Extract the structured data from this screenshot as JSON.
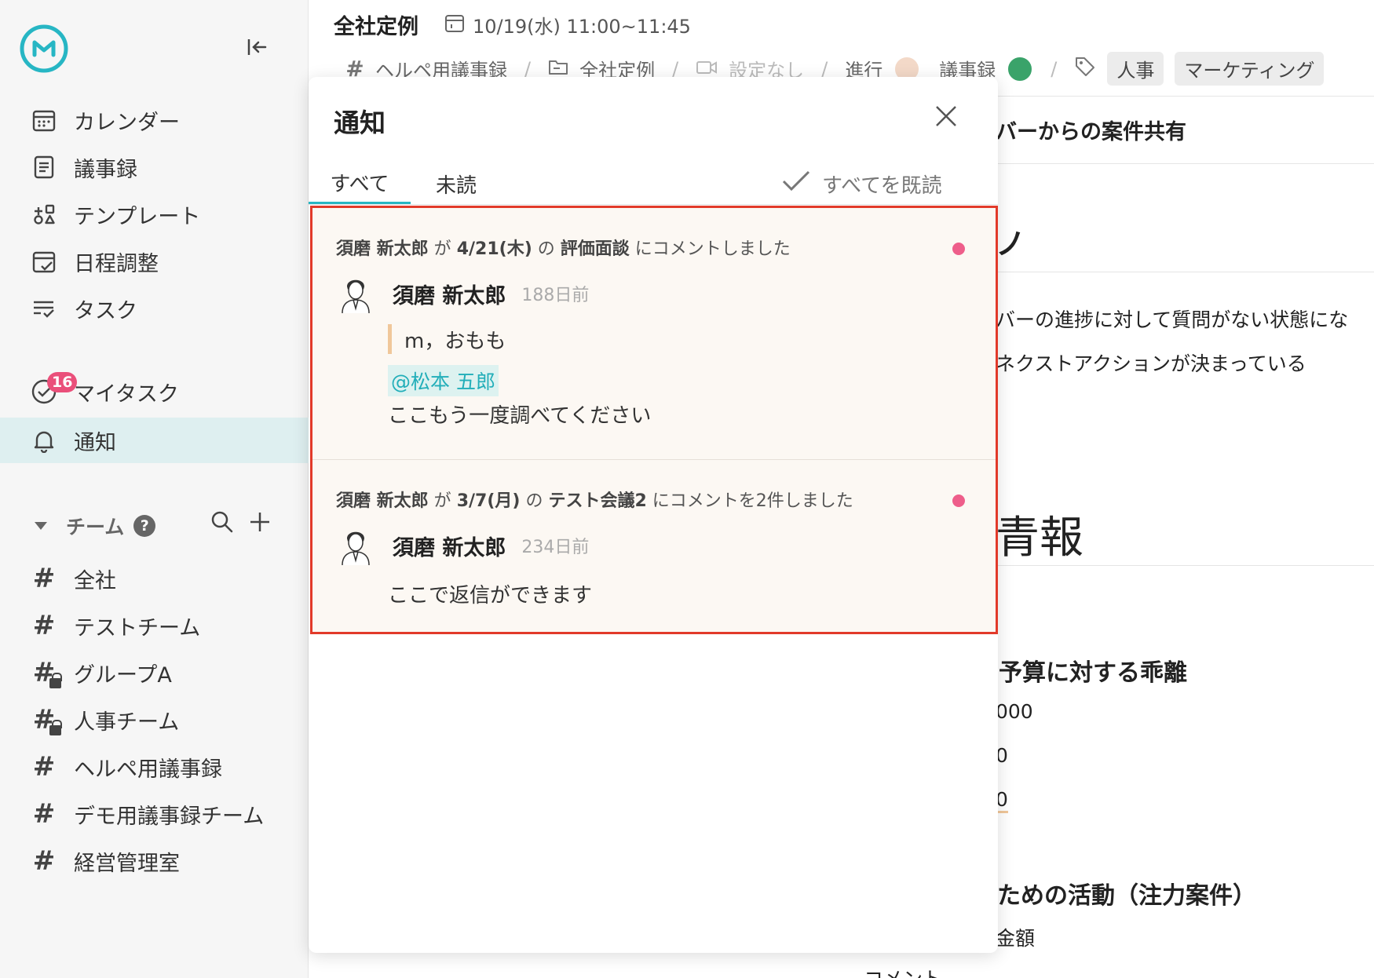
{
  "colors": {
    "accent": "#27b6c4",
    "badge": "#ea4f7a",
    "highlight_border": "#e23a2a",
    "unread_dot": "#ee5e8a"
  },
  "sidebar": {
    "logo": "app-logo",
    "nav": [
      {
        "label": "カレンダー",
        "icon": "calendar-icon"
      },
      {
        "label": "議事録",
        "icon": "document-icon"
      },
      {
        "label": "テンプレート",
        "icon": "template-icon"
      },
      {
        "label": "日程調整",
        "icon": "schedule-icon"
      },
      {
        "label": "タスク",
        "icon": "task-list-icon"
      }
    ],
    "my_task": {
      "label": "マイタスク",
      "badge": "16"
    },
    "notifications": {
      "label": "通知"
    },
    "team_header": "チーム",
    "teams": [
      {
        "label": "全社",
        "locked": false
      },
      {
        "label": "テストチーム",
        "locked": false
      },
      {
        "label": "グループA",
        "locked": true
      },
      {
        "label": "人事チーム",
        "locked": true
      },
      {
        "label": "ヘルペ用議事録",
        "locked": false
      },
      {
        "label": "デモ用議事録チーム",
        "locked": false
      },
      {
        "label": "経営管理室",
        "locked": false
      }
    ]
  },
  "header": {
    "title": "全社定例",
    "datetime": "10/19(水) 11:00~11:45",
    "breadcrumb_team": "ヘルペ用議事録",
    "breadcrumb_folder": "全社定例",
    "video": "設定なし",
    "facilitator_label": "進行",
    "minutes_label": "議事録",
    "tags": [
      "人事",
      "マーケティング"
    ]
  },
  "background": {
    "line1": "バーからの案件共有",
    "line2": "ノ",
    "line3": "バーの進捗に対して質問がない状態にな",
    "line4": "ネクストアクションが決まっている",
    "line5": "青報",
    "line6": "予算に対する乖離",
    "line7": "000",
    "line8": "0",
    "line9": "0",
    "line10": "ための活動（注力案件）",
    "line11": "金額",
    "line12": "コメント"
  },
  "panel": {
    "title": "通知",
    "tab_all": "すべて",
    "tab_unread": "未読",
    "mark_all_read": "すべてを既読",
    "items": [
      {
        "actor": "須磨 新太郎",
        "part1": "が",
        "date": "4/21(木)",
        "part2": "の",
        "meeting": "評価面談",
        "action": "にコメントしました",
        "author": "須磨 新太郎",
        "ago": "188日前",
        "quote": "m，おもも",
        "mention": "@松本 五郎",
        "text": "ここもう一度調べてください"
      },
      {
        "actor": "須磨 新太郎",
        "part1": "が",
        "date": "3/7(月)",
        "part2": "の",
        "meeting": "テスト会議2",
        "action": "にコメントを2件しました",
        "author": "須磨 新太郎",
        "ago": "234日前",
        "text": "ここで返信ができます"
      }
    ]
  }
}
